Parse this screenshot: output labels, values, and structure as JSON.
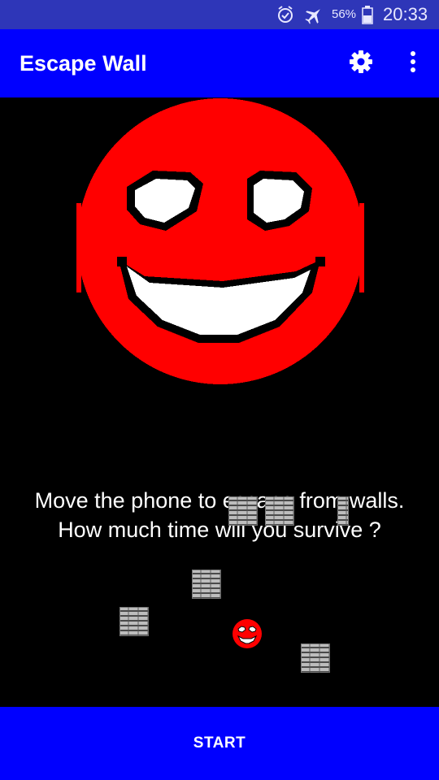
{
  "status_bar": {
    "battery": "56%",
    "time": "20:33",
    "icons": [
      "alarm-icon",
      "airplane-mode-icon",
      "battery-icon"
    ]
  },
  "toolbar": {
    "title": "Escape Wall",
    "icons": [
      "settings-gear-icon",
      "overflow-menu-icon"
    ],
    "background": "#0000ff"
  },
  "game": {
    "tagline_line1": "Move the phone to escape from walls.",
    "tagline_line2": "How much time will you survive ?",
    "hero_icon": "red-smiley-face-icon",
    "player_icon": "red-smiley-ball-icon",
    "wall_icon": "brick-wall-block-icon",
    "background": "#000000",
    "face_color": "#ff0000"
  },
  "start_button": {
    "label": "START",
    "background": "#0000ff"
  }
}
